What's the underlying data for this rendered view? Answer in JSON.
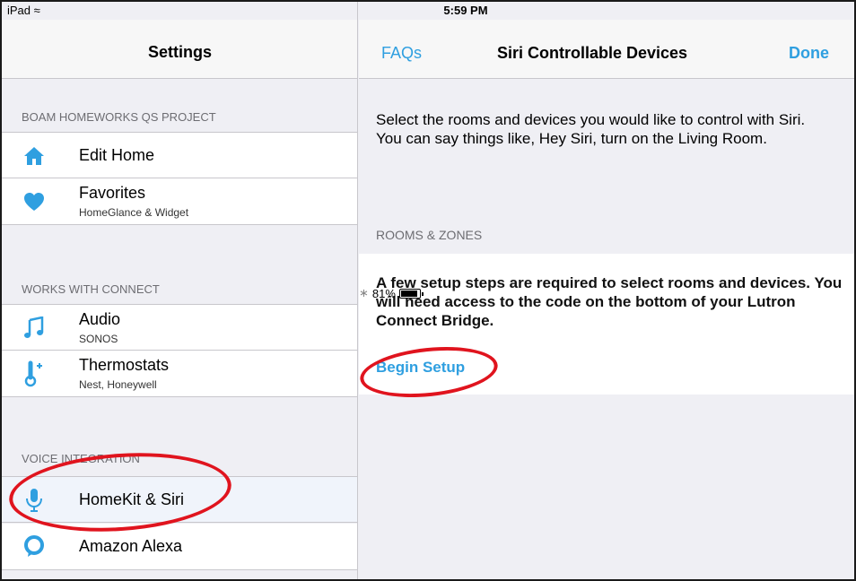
{
  "status_bar": {
    "device": "iPad",
    "time": "5:59 PM",
    "battery": "81%",
    "battery_level": 0.81
  },
  "left_pane": {
    "title": "Settings",
    "sections": [
      {
        "header": "BOAM HOMEWORKS QS PROJECT",
        "items": [
          {
            "label": "Edit Home",
            "sublabel": "",
            "icon": "home-icon"
          },
          {
            "label": "Favorites",
            "sublabel": "HomeGlance & Widget",
            "icon": "heart-icon"
          }
        ]
      },
      {
        "header": "WORKS WITH CONNECT",
        "items": [
          {
            "label": "Audio",
            "sublabel": "SONOS",
            "icon": "music-note-icon"
          },
          {
            "label": "Thermostats",
            "sublabel": "Nest, Honeywell",
            "icon": "thermometer-icon"
          }
        ]
      },
      {
        "header": "VOICE INTEGRATION",
        "items": [
          {
            "label": "HomeKit & Siri",
            "sublabel": "",
            "icon": "microphone-icon",
            "selected": true
          },
          {
            "label": "Amazon Alexa",
            "sublabel": "",
            "icon": "alexa-icon"
          }
        ]
      }
    ]
  },
  "right_pane": {
    "nav": {
      "left_button": "FAQs",
      "title": "Siri Controllable Devices",
      "right_button": "Done"
    },
    "intro": "Select the rooms and devices you would like to control with Siri. You can say things like, Hey Siri, turn on the Living Room.",
    "rooms_header": "ROOMS & ZONES",
    "setup_message": "A few setup steps are required to select rooms and devices. You will need access to the code on the bottom of your Lutron Connect Bridge.",
    "begin_setup": "Begin Setup"
  },
  "colors": {
    "accent": "#2f9fe0",
    "annotation": "#e0141e",
    "background": "#efeff4"
  }
}
